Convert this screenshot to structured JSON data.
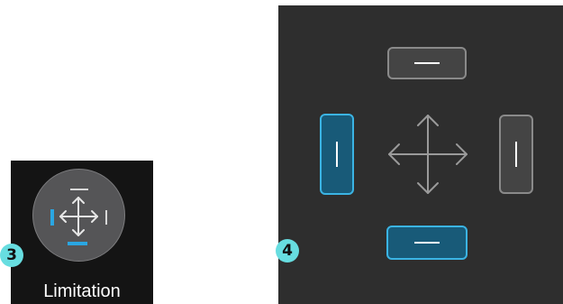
{
  "tool_button": {
    "label": "Limitation",
    "icon": "move-limit-icon",
    "step_badge": "3"
  },
  "limit_editor": {
    "step_badge": "4",
    "center_icon": "move-arrows-icon",
    "directions": [
      {
        "name": "top",
        "icon": "horizontal-bar",
        "active": false
      },
      {
        "name": "left",
        "icon": "vertical-bar",
        "active": true
      },
      {
        "name": "right",
        "icon": "vertical-bar",
        "active": false
      },
      {
        "name": "bottom",
        "icon": "horizontal-bar",
        "active": true
      }
    ]
  },
  "colors": {
    "accent_blue": "#3bb4e4",
    "active_fill": "#185a78",
    "badge_cyan": "#67dde0",
    "panel_dark": "#2e2e2e",
    "tool_bg": "#141414"
  }
}
